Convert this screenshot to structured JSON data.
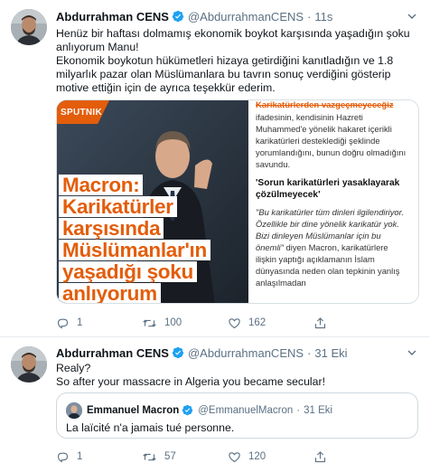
{
  "tweets": [
    {
      "author_name": "Abdurrahman CENS",
      "handle": "@AbdurrahmanCENS",
      "separator": "·",
      "time": "11s",
      "body": [
        "Henüz bir haftası dolmamış ekonomik boykot karşısında yaşadığın şoku anlıyorum Manu!",
        "Ekonomik boykotun hükümetleri hizaya getirdiğini kanıtladığın ve 1.8 milyarlık pazar olan Müslümanlara bu tavrın sonuç verdiğini gösterip motive ettiğin için de ayrıca teşekkür ederim."
      ],
      "media": {
        "brand": "SPUTNIK",
        "headline_lines": [
          "Macron:",
          "Karikatürler",
          "karşısında",
          "Müslümanlar'ın",
          "yaşadığı şoku",
          "anlıyorum"
        ],
        "article_title": "Karikatürlerden vazgeçmeyeceğiz",
        "article_para1": "ifadesinin, kendisinin Hazreti Muhammed'e yönelik hakaret içerikli karikatürleri desteklediği şeklinde yorumlandığını, bunun doğru olmadığını savundu.",
        "article_subhead": "'Sorun karikatürleri yasaklayarak çözülmeyecek'",
        "article_quote": "\"Bu karikatürler tüm dinleri ilgilendiriyor. Özellikle bir dine yönelik karikatür yok. Bizi dinleyen Müslümanlar için bu önemli\"",
        "article_quote_tail": " diyen Macron, karikatürlere ilişkin yaptığı açıklamanın İslam dünyasında neden olan tepkinin yanlış anlaşılmadan"
      },
      "actions": {
        "replies": "1",
        "retweets": "100",
        "likes": "162"
      }
    },
    {
      "author_name": "Abdurrahman CENS",
      "handle": "@AbdurrahmanCENS",
      "separator": "·",
      "time": "31 Eki",
      "body": [
        "Realy?",
        "So after your massacre in Algeria you became secular!"
      ],
      "quoted": {
        "author_name": "Emmanuel Macron",
        "handle": "@EmmanuelMacron",
        "separator": "·",
        "time": "31 Eki",
        "text": "La laïcité n'a jamais tué personne."
      },
      "actions": {
        "replies": "1",
        "retweets": "57",
        "likes": "120"
      }
    }
  ],
  "colors": {
    "verified": "#1da1f2",
    "secondary_text": "#5b7083",
    "sputnik_orange": "#e35d0b",
    "border": "#e6ecf0"
  },
  "icons": [
    "chevron-down-icon",
    "verified-badge-icon",
    "reply-icon",
    "retweet-icon",
    "like-icon",
    "share-icon"
  ]
}
